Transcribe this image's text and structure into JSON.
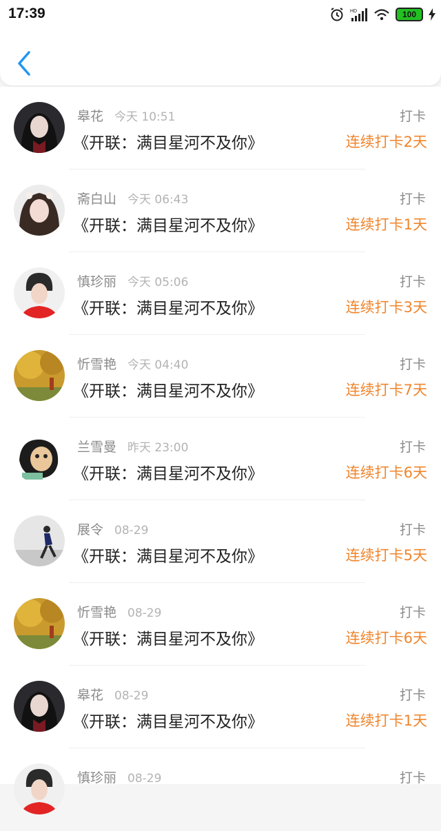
{
  "status": {
    "time": "17:39",
    "battery": "100"
  },
  "colors": {
    "accent": "#2196f3",
    "streak": "#f0852c"
  },
  "items": [
    {
      "name": "皋花",
      "time": "今天 10:51",
      "title": "《开联：满目星河不及你》",
      "action": "打卡",
      "streak": "连续打卡2天"
    },
    {
      "name": "斋白山",
      "time": "今天 06:43",
      "title": "《开联：满目星河不及你》",
      "action": "打卡",
      "streak": "连续打卡1天"
    },
    {
      "name": "慎珍丽",
      "time": "今天 05:06",
      "title": "《开联：满目星河不及你》",
      "action": "打卡",
      "streak": "连续打卡3天"
    },
    {
      "name": "忻雪艳",
      "time": "今天 04:40",
      "title": "《开联：满目星河不及你》",
      "action": "打卡",
      "streak": "连续打卡7天"
    },
    {
      "name": "兰雪曼",
      "time": "昨天 23:00",
      "title": "《开联：满目星河不及你》",
      "action": "打卡",
      "streak": "连续打卡6天"
    },
    {
      "name": "展令",
      "time": "08-29",
      "title": "《开联：满目星河不及你》",
      "action": "打卡",
      "streak": "连续打卡5天"
    },
    {
      "name": "忻雪艳",
      "time": "08-29",
      "title": "《开联：满目星河不及你》",
      "action": "打卡",
      "streak": "连续打卡6天"
    },
    {
      "name": "皋花",
      "time": "08-29",
      "title": "《开联：满目星河不及你》",
      "action": "打卡",
      "streak": "连续打卡1天"
    },
    {
      "name": "慎珍丽",
      "time": "08-29",
      "title": "",
      "action": "打卡",
      "streak": ""
    }
  ]
}
